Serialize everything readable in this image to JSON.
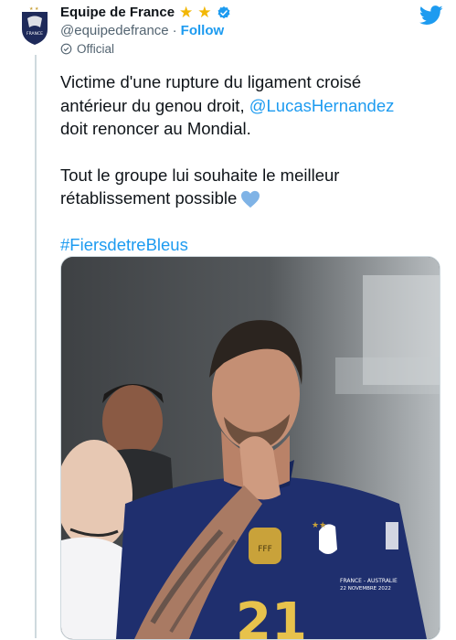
{
  "tweet": {
    "display_name": "Equipe de France",
    "stars": [
      "★",
      "★"
    ],
    "handle": "@equipedefrance",
    "separator": "·",
    "follow_label": "Follow",
    "official_label": "Official",
    "badge_text": "FRANCE",
    "lines": {
      "l1": "Victime d'une rupture du ligament croisé",
      "l2a": "antérieur du genou droit, ",
      "mention": "@LucasHernandez",
      "l3": "doit renoncer au Mondial.",
      "l4": "Tout le groupe lui souhaite le meilleur",
      "l5": "rétablissement possible",
      "hashtag": "#FiersdetreBleus"
    },
    "icons": {
      "avatar": "fff-crest-logo",
      "verified": "verified-badge-icon",
      "official": "official-check-icon",
      "twitter": "twitter-bird-icon",
      "heart": "blue-heart-emoji"
    },
    "colors": {
      "link": "#1d9bf0",
      "star": "#f2b705",
      "heart": "#7fb3e6",
      "jersey": "#1f2f6e"
    }
  },
  "media": {
    "description_hidden": false,
    "jersey_number": "21",
    "jersey_caption_1": "FRANCE - AUSTRALIE",
    "jersey_caption_2": "22 NOVEMBRE 2022"
  }
}
